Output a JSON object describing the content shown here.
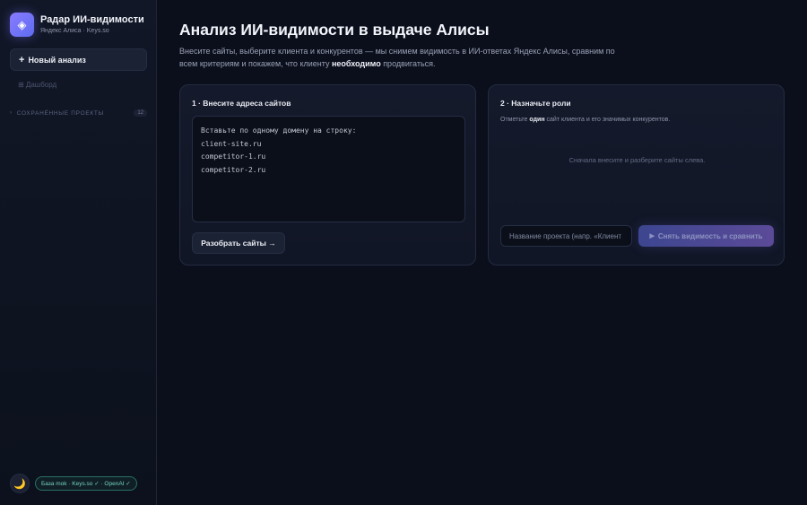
{
  "sidebar": {
    "brand": {
      "logo_icon": "diamond-icon",
      "title": "Радар ИИ-видимости",
      "subtitle": "Яндекс Алиса · Keys.so"
    },
    "nav": {
      "new_analysis": "Новый анализ",
      "new_analysis_icon": "+",
      "dashboard": "⊞ Дашборд"
    },
    "saved_projects": {
      "label": "СОХРАНЁННЫЕ ПРОЕКТЫ",
      "count": "12"
    },
    "footer": {
      "theme_icon": "🌙",
      "status": "База mok · Keys.so ✓ · OpenAI ✓"
    }
  },
  "main": {
    "title": "Анализ ИИ-видимости в выдаче Алисы",
    "description": {
      "text_before": "Внесите сайты, выберите клиента и конкурентов — мы снимем видимость в ИИ-ответах Яндекс Алисы, сравним по всем критериям и покажем, что клиенту ",
      "text_bold": "необходимо",
      "text_after": " продвигаться."
    },
    "step1": {
      "title": "1 · Внесите адреса сайтов",
      "textarea_placeholder": "Вставьте по одному домену на строку:\nclient-site.ru\ncompetitor-1.ru\ncompetitor-2.ru",
      "parse_button": "Разобрать сайты →"
    },
    "step2": {
      "title": "2 · Назначьте роли",
      "hint_before": "Отметьте ",
      "hint_bold": "один",
      "hint_after": " сайт клиента и его значимых конкурентов.",
      "empty": "Сначала внесите и разберите сайты слева.",
      "project_placeholder": "Название проекта (напр. «Клиент · март»)",
      "run_button": "Снять видимость и сравнить",
      "run_icon": "▶"
    }
  },
  "colors": {
    "background": "#0b0f1c",
    "accent": "#7b6cff",
    "status_ok": "#79d3c0"
  }
}
